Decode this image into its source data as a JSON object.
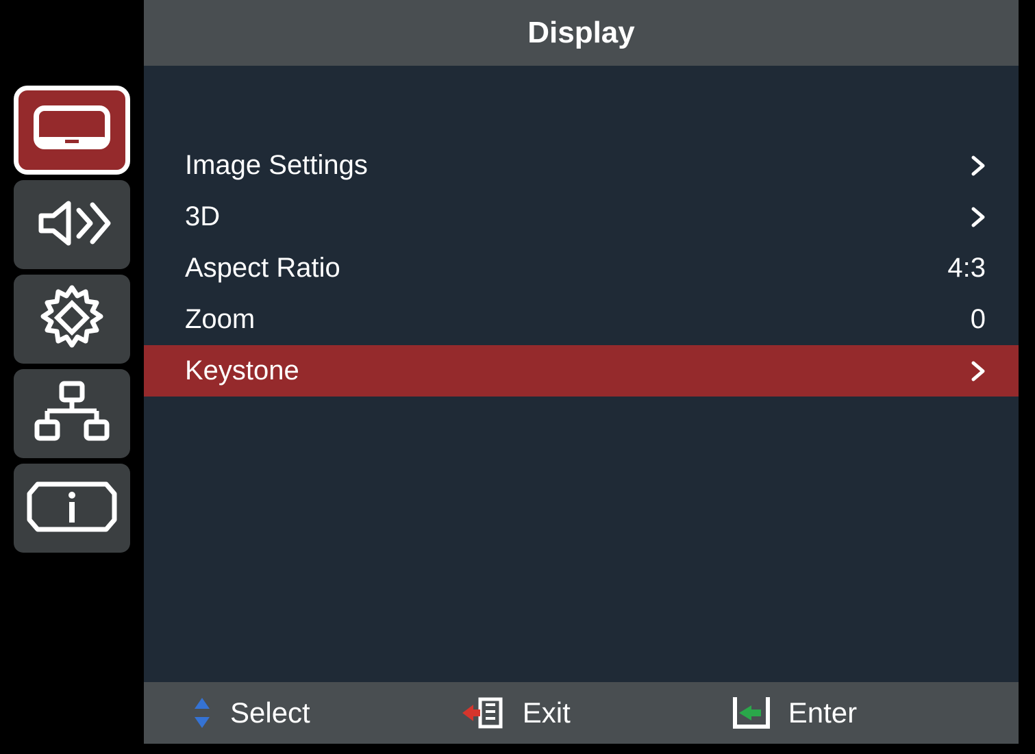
{
  "header": {
    "title": "Display"
  },
  "sidebar": {
    "tabs": [
      {
        "name": "display",
        "active": true
      },
      {
        "name": "audio",
        "active": false
      },
      {
        "name": "setup",
        "active": false
      },
      {
        "name": "network",
        "active": false
      },
      {
        "name": "info",
        "active": false
      }
    ]
  },
  "menu": {
    "items": [
      {
        "label": "Image Settings",
        "value": "",
        "submenu": true,
        "highlight": false
      },
      {
        "label": "3D",
        "value": "",
        "submenu": true,
        "highlight": false
      },
      {
        "label": "Aspect Ratio",
        "value": "4:3",
        "submenu": false,
        "highlight": false
      },
      {
        "label": "Zoom",
        "value": "0",
        "submenu": false,
        "highlight": false
      },
      {
        "label": "Keystone",
        "value": "",
        "submenu": true,
        "highlight": true
      }
    ]
  },
  "footer": {
    "select_label": "Select",
    "exit_label": "Exit",
    "enter_label": "Enter"
  }
}
